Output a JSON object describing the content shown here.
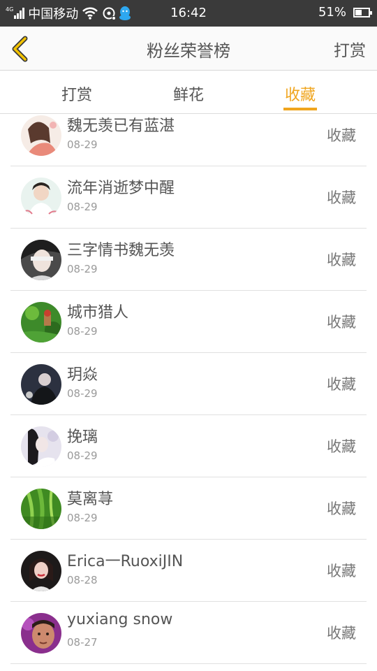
{
  "status_bar": {
    "network": "4G",
    "carrier": "中国移动",
    "time": "16:42",
    "battery_percent": "51%",
    "battery_level": 0.51,
    "icons": [
      "signal-icon",
      "wifi-icon",
      "sync-icon",
      "qq-icon",
      "battery-icon"
    ]
  },
  "header": {
    "back_icon": "chevron-left-icon",
    "title": "粉丝荣誉榜",
    "action": "打赏"
  },
  "tabs": [
    {
      "label": "打赏",
      "active": false
    },
    {
      "label": "鲜花",
      "active": false
    },
    {
      "label": "收藏",
      "active": true
    }
  ],
  "colors": {
    "accent": "#f0a51e",
    "status_bar": "#3a3a3a"
  },
  "fans": [
    {
      "name": "魏无羡已有蓝湛",
      "date": "08-29",
      "action": "收藏"
    },
    {
      "name": "流年消逝梦中醒",
      "date": "08-29",
      "action": "收藏"
    },
    {
      "name": "三字情书魏无羡",
      "date": "08-29",
      "action": "收藏"
    },
    {
      "name": "城市猎人",
      "date": "08-29",
      "action": "收藏"
    },
    {
      "name": "玥焱",
      "date": "08-29",
      "action": "收藏"
    },
    {
      "name": "挽璃",
      "date": "08-29",
      "action": "收藏"
    },
    {
      "name": "莫离荨",
      "date": "08-29",
      "action": "收藏"
    },
    {
      "name": "Erica一RuoxiJIN",
      "date": "08-28",
      "action": "收藏"
    },
    {
      "name": "yuxiang snow",
      "date": "08-27",
      "action": "收藏"
    }
  ]
}
